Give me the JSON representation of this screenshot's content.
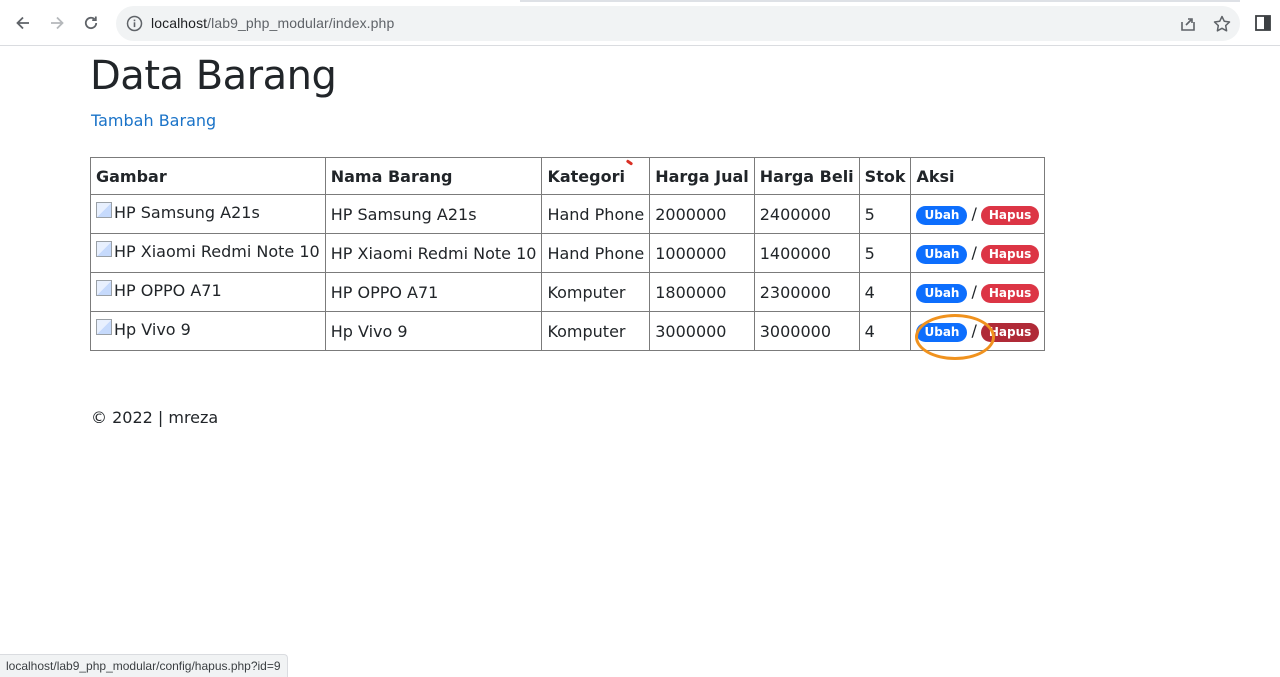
{
  "browser": {
    "url_host": "localhost",
    "url_path": "/lab9_php_modular/index.php",
    "status_url": "localhost/lab9_php_modular/config/hapus.php?id=9"
  },
  "page": {
    "title": "Data Barang",
    "add_link": "Tambah Barang",
    "footer": "© 2022 | mreza"
  },
  "table": {
    "headers": [
      "Gambar",
      "Nama Barang",
      "Kategori",
      "Harga Jual",
      "Harga Beli",
      "Stok",
      "Aksi"
    ],
    "rows": [
      {
        "img_alt": "HP Samsung A21s",
        "nama": "HP Samsung A21s",
        "kategori": "Hand Phone",
        "harga_jual": "2000000",
        "harga_beli": "2400000",
        "stok": "5"
      },
      {
        "img_alt": "HP Xiaomi Redmi Note 10",
        "nama": "HP Xiaomi Redmi Note 10",
        "kategori": "Hand Phone",
        "harga_jual": "1000000",
        "harga_beli": "1400000",
        "stok": "5"
      },
      {
        "img_alt": "HP OPPO A71",
        "nama": "HP OPPO A71",
        "kategori": "Komputer",
        "harga_jual": "1800000",
        "harga_beli": "2300000",
        "stok": "4"
      },
      {
        "img_alt": "Hp Vivo 9",
        "nama": "Hp Vivo 9",
        "kategori": "Komputer",
        "harga_jual": "3000000",
        "harga_beli": "3000000",
        "stok": "4"
      }
    ],
    "action_edit": "Ubah",
    "action_separator": "/",
    "action_delete": "Hapus"
  },
  "colors": {
    "edit_badge": "#0d6efd",
    "delete_badge": "#dc3545",
    "link": "#1a73c8",
    "highlight_ring": "#f0921e"
  },
  "icons": [
    "back-arrow-icon",
    "forward-arrow-icon",
    "reload-icon",
    "info-icon",
    "share-icon",
    "star-icon",
    "side-panel-icon",
    "broken-image-icon"
  ]
}
